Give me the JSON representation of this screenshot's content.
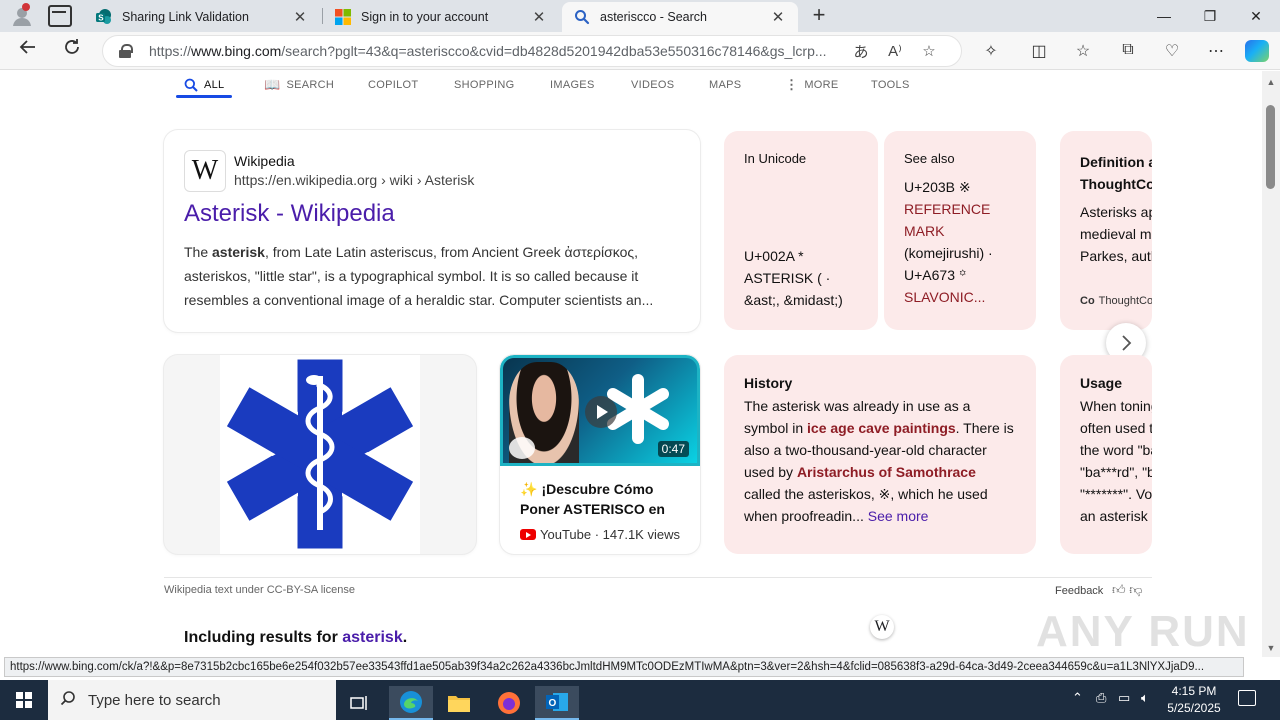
{
  "browser": {
    "tabs": [
      {
        "title": "Sharing Link Validation",
        "active": false
      },
      {
        "title": "Sign in to your account",
        "active": false
      },
      {
        "title": "asteriscco - Search",
        "active": true
      }
    ],
    "new_tab": "+",
    "window": {
      "minimize": "—",
      "restore": "❐",
      "close": "✕"
    },
    "url_prefix": "https://",
    "url_host": "www.bing.com",
    "url_rest": "/search?pglt=43&q=asteriscco&cvid=db4828d5201942dba53e550316c78146&gs_lcrp...",
    "status_url": "https://www.bing.com/ck/a?!&&p=8e7315b2cbc165be6e254f032b57ee33543ffd1ae505ab39f34a2c262a4336bcJmltdHM9MTc0ODEzMTIwMA&ptn=3&ver=2&hsh=4&fclid=085638f3-a29d-64ca-3d49-2ceea344659c&u=a1L3NlYXJjaD9..."
  },
  "scopes": [
    {
      "label": "ALL",
      "icon": "search-icon",
      "active": true
    },
    {
      "label": "SEARCH",
      "icon": "book-icon",
      "active": false
    },
    {
      "label": "COPILOT",
      "active": false
    },
    {
      "label": "SHOPPING",
      "active": false
    },
    {
      "label": "IMAGES",
      "active": false
    },
    {
      "label": "VIDEOS",
      "active": false
    },
    {
      "label": "MAPS",
      "active": false
    },
    {
      "label": "MORE",
      "icon": "more-vertical-icon",
      "active": false
    },
    {
      "label": "TOOLS",
      "active": false
    }
  ],
  "wiki_result": {
    "logo": "W",
    "site": "Wikipedia",
    "url": "https://en.wikipedia.org › wiki › Asterisk",
    "title": "Asterisk - Wikipedia",
    "snippet_bold": "asterisk",
    "snippet_pre": "The ",
    "snippet_post": ", from Late Latin asteriscus, from Ancient Greek ἀστερίσκος, asteriskos, \"little star\", is a typographical symbol. It is so called because it resembles a conventional image of a heraldic star. Computer scientists an..."
  },
  "unicode_card": {
    "title": "In Unicode",
    "lines": [
      "U+002A *",
      "ASTERISK ( ·",
      "&ast;, &midast;)"
    ]
  },
  "seealso_card": {
    "title": "See also",
    "line1": "U+203B ※",
    "line2": "REFERENCE",
    "line3": "MARK",
    "line4": "(komejirushi) ·",
    "line5": "U+A673 ꙳",
    "line6": "SLAVONIC..."
  },
  "definition_card": {
    "title_1": "Definition a",
    "title_2": "ThoughtCo",
    "lines": [
      "Asterisks ap",
      "medieval ma",
      "Parkes, auth"
    ],
    "source": "ThoughtCo"
  },
  "history_card": {
    "title": "History",
    "t1": "The asterisk was already in use as a symbol in ",
    "link1": "ice age cave paintings",
    "t2": ". There is also a two-thousand-year-old character used by ",
    "link2": "Aristarchus of Samothrace",
    "t3": " called the asteriskos, ※, which he used when proofreadin...",
    "see_more": "See more"
  },
  "usage_card": {
    "title": "Usage",
    "lines": [
      "When toning",
      "often used t",
      "the word \"ba",
      "\"ba***rd\", \"b",
      "\"*******\". Vo",
      "an asterisk"
    ]
  },
  "video": {
    "duration": "0:47",
    "title": "¡Descubre Cómo Poner ASTERISCO en",
    "source": "YouTube · 147.1K views"
  },
  "footer": {
    "license": "Wikipedia text under CC-BY-SA license",
    "feedback": "Feedback",
    "including_pre": "Including results for ",
    "including_link": "asterisk",
    "including_post": ".",
    "wiki_mini": "W"
  },
  "watermark": "ANY RUN",
  "taskbar": {
    "search_placeholder": "Type here to search",
    "time": "4:15 PM",
    "date": "5/25/2025"
  },
  "colors": {
    "accent": "#174ae4",
    "link_visited": "#4a1daa",
    "fact_card_bg": "#fceaea",
    "fact_link": "#8e1d25",
    "taskbar": "#1c2c3f"
  }
}
